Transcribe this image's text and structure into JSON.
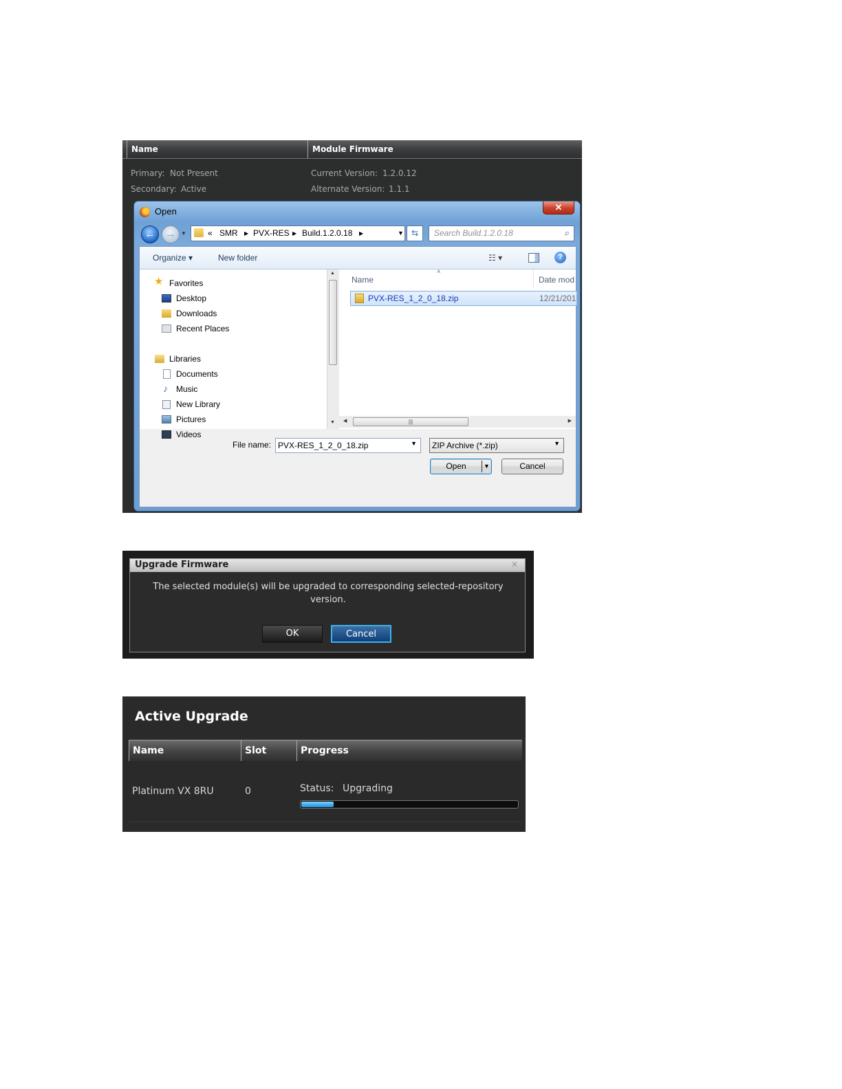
{
  "module_panel": {
    "headers": [
      "Name",
      "Module Firmware"
    ],
    "primary_label": "Primary:",
    "primary_value": "Not Present",
    "secondary_label": "Secondary:",
    "secondary_value": "Active",
    "current_version_label": "Current Version:",
    "current_version_value": "1.2.0.12",
    "alternate_version_label": "Alternate Version:",
    "alternate_version_value": "1.1.1"
  },
  "open_dialog": {
    "title": "Open",
    "close_glyph": "✕",
    "breadcrumb": {
      "overflow": "«",
      "items": [
        "SMR",
        "PVX-RES",
        "Build.1.2.0.18"
      ]
    },
    "search_placeholder": "Search Build.1.2.0.18",
    "toolbar": {
      "organize": "Organize ▾",
      "new_folder": "New folder"
    },
    "favorites_header": "Favorites",
    "favorites": [
      "Desktop",
      "Downloads",
      "Recent Places"
    ],
    "libraries_header": "Libraries",
    "libraries": [
      "Documents",
      "Music",
      "New Library",
      "Pictures",
      "Videos"
    ],
    "columns": {
      "name": "Name",
      "date": "Date mod"
    },
    "files": [
      {
        "name": "PVX-RES_1_2_0_18.zip",
        "date": "12/21/201"
      }
    ],
    "file_name_label": "File name:",
    "file_name_value": "PVX-RES_1_2_0_18.zip",
    "file_type_value": "ZIP Archive (*.zip)",
    "open_label": "Open",
    "cancel_label": "Cancel"
  },
  "upgrade_dialog": {
    "title": "Upgrade Firmware",
    "close_glyph": "✕",
    "message": "The selected module(s) will be upgraded to corresponding selected-repository version.",
    "ok_label": "OK",
    "cancel_label": "Cancel"
  },
  "active_upgrade": {
    "title": "Active Upgrade",
    "headers": [
      "Name",
      "Slot",
      "Progress"
    ],
    "rows": [
      {
        "name": "Platinum VX 8RU",
        "slot": "0",
        "status_label": "Status:",
        "status_value": "Upgrading",
        "progress_percent": 15
      }
    ]
  },
  "colors": {
    "accent_blue": "#1f8fe0",
    "dialog_cancel_border": "#3fb2ea"
  }
}
